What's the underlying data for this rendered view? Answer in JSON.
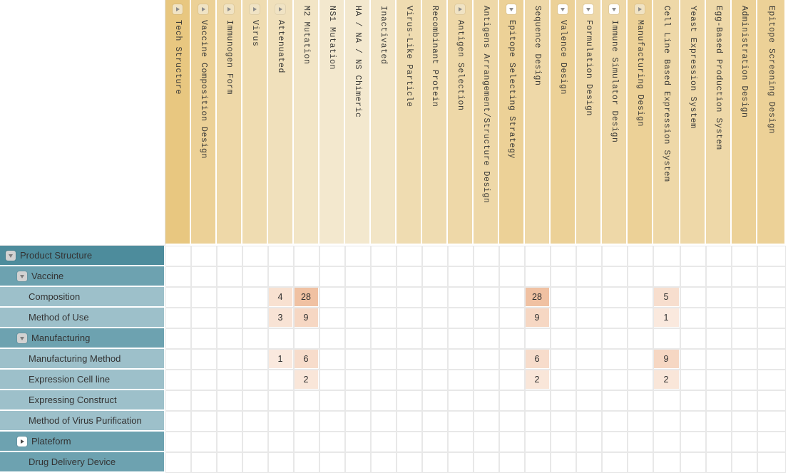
{
  "columns": [
    {
      "label": "Tech Structure",
      "toggle": "collapsed",
      "level": 0,
      "width": 36,
      "bg": "#e8c780"
    },
    {
      "label": "Vaccine Composition Design",
      "toggle": "collapsed",
      "level": 1,
      "width": 36,
      "bg": "#ecd197"
    },
    {
      "label": "Immunogen Form",
      "toggle": "collapsed",
      "level": 2,
      "width": 36,
      "bg": "#eed8a8"
    },
    {
      "label": "Virus",
      "toggle": "collapsed",
      "level": 3,
      "width": 36,
      "bg": "#efdcb1"
    },
    {
      "label": "Attenuated",
      "toggle": "collapsed",
      "level": 4,
      "width": 36,
      "bg": "#f0e0bb"
    },
    {
      "label": "M2 Mutation",
      "toggle": "none",
      "level": 5,
      "width": 36,
      "bg": "#f2e5c6"
    },
    {
      "label": "NS1 Mutation",
      "toggle": "none",
      "level": 5,
      "width": 36,
      "bg": "#f3e8ce"
    },
    {
      "label": "HA / NA / NS Chimeric",
      "toggle": "none",
      "level": 5,
      "width": 36,
      "bg": "#f3e8ce"
    },
    {
      "label": "Inactivated",
      "toggle": "none",
      "level": 4,
      "width": 36,
      "bg": "#f2e5c6"
    },
    {
      "label": "Virus-Like Particle",
      "toggle": "none",
      "level": 3,
      "width": 36,
      "bg": "#efdcb1"
    },
    {
      "label": "Recombinant Protein",
      "toggle": "none",
      "level": 3,
      "width": 36,
      "bg": "#efdcb1"
    },
    {
      "label": "Antigen Selection",
      "toggle": "collapsed",
      "level": 2,
      "width": 36,
      "bg": "#eed8a8"
    },
    {
      "label": "Antigens Arrangement/Structure Design",
      "toggle": "none",
      "level": 2,
      "width": 36,
      "bg": "#eed8a8"
    },
    {
      "label": "Epitope Selecting Strategy",
      "toggle": "expanded",
      "level": 2,
      "width": 36,
      "bg": "#ecd197"
    },
    {
      "label": "Sequence Design",
      "toggle": "none",
      "level": 3,
      "width": 36,
      "bg": "#eed8a8"
    },
    {
      "label": "Valence Design",
      "toggle": "expanded",
      "level": 2,
      "width": 36,
      "bg": "#ecd197"
    },
    {
      "label": "Formulation Design",
      "toggle": "expanded",
      "level": 2,
      "width": 36,
      "bg": "#eed8a8"
    },
    {
      "label": "Immune Simulator Design",
      "toggle": "expanded",
      "level": 2,
      "width": 36,
      "bg": "#eed8a8"
    },
    {
      "label": "Manufacturing Design",
      "toggle": "collapsed",
      "level": 1,
      "width": 36,
      "bg": "#ecd197"
    },
    {
      "label": "Cell Line Based Expression System",
      "toggle": "none",
      "level": 2,
      "width": 38,
      "bg": "#eed8a8"
    },
    {
      "label": "Yeast Expression System",
      "toggle": "none",
      "level": 2,
      "width": 36,
      "bg": "#eed8a8"
    },
    {
      "label": "Egg-Based Production System",
      "toggle": "none",
      "level": 2,
      "width": 36,
      "bg": "#eed8a8"
    },
    {
      "label": "Administration Design",
      "toggle": "none",
      "level": 1,
      "width": 36,
      "bg": "#ecd197"
    },
    {
      "label": "Epitope Screening Design",
      "toggle": "none",
      "level": 1,
      "width": 40,
      "bg": "#ecd197"
    }
  ],
  "rows": [
    {
      "label": "Product Structure",
      "level": 0,
      "toggle": "expanded"
    },
    {
      "label": "Vaccine",
      "level": 1,
      "toggle": "expanded"
    },
    {
      "label": "Composition",
      "level": 2,
      "toggle": "none"
    },
    {
      "label": "Method of Use",
      "level": 2,
      "toggle": "none"
    },
    {
      "label": "Manufacturing",
      "level": 1,
      "toggle": "expanded"
    },
    {
      "label": "Manufacturing Method",
      "level": 2,
      "toggle": "none"
    },
    {
      "label": "Expression Cell line",
      "level": 2,
      "toggle": "none"
    },
    {
      "label": "Expressing Construct",
      "level": 2,
      "toggle": "none"
    },
    {
      "label": "Method of Virus Purification",
      "level": 2,
      "toggle": "none"
    },
    {
      "label": "Plateform",
      "level": 1,
      "toggle": "collapsed"
    },
    {
      "label": "Drug Delivery Device",
      "level": 1,
      "toggle": "none"
    }
  ],
  "cells": [
    [
      null,
      null,
      null,
      null,
      null,
      null,
      null,
      null,
      null,
      null,
      null,
      null,
      null,
      null,
      null,
      null,
      null,
      null,
      null,
      null,
      null,
      null,
      null,
      null
    ],
    [
      null,
      null,
      null,
      null,
      null,
      null,
      null,
      null,
      null,
      null,
      null,
      null,
      null,
      null,
      null,
      null,
      null,
      null,
      null,
      null,
      null,
      null,
      null,
      null
    ],
    [
      null,
      null,
      null,
      null,
      "4",
      "28",
      null,
      null,
      null,
      null,
      null,
      null,
      null,
      null,
      "28",
      null,
      null,
      null,
      null,
      "5",
      null,
      null,
      null,
      null
    ],
    [
      null,
      null,
      null,
      null,
      "3",
      "9",
      null,
      null,
      null,
      null,
      null,
      null,
      null,
      null,
      "9",
      null,
      null,
      null,
      null,
      "1",
      null,
      null,
      null,
      null
    ],
    [
      null,
      null,
      null,
      null,
      null,
      null,
      null,
      null,
      null,
      null,
      null,
      null,
      null,
      null,
      null,
      null,
      null,
      null,
      null,
      null,
      null,
      null,
      null,
      null
    ],
    [
      null,
      null,
      null,
      null,
      "1",
      "6",
      null,
      null,
      null,
      null,
      null,
      null,
      null,
      null,
      "6",
      null,
      null,
      null,
      null,
      "9",
      null,
      null,
      null,
      null
    ],
    [
      null,
      null,
      null,
      null,
      null,
      "2",
      null,
      null,
      null,
      null,
      null,
      null,
      null,
      null,
      "2",
      null,
      null,
      null,
      null,
      "2",
      null,
      null,
      null,
      null
    ],
    [
      null,
      null,
      null,
      null,
      null,
      null,
      null,
      null,
      null,
      null,
      null,
      null,
      null,
      null,
      null,
      null,
      null,
      null,
      null,
      null,
      null,
      null,
      null,
      null
    ],
    [
      null,
      null,
      null,
      null,
      null,
      null,
      null,
      null,
      null,
      null,
      null,
      null,
      null,
      null,
      null,
      null,
      null,
      null,
      null,
      null,
      null,
      null,
      null,
      null
    ],
    [
      null,
      null,
      null,
      null,
      null,
      null,
      null,
      null,
      null,
      null,
      null,
      null,
      null,
      null,
      null,
      null,
      null,
      null,
      null,
      null,
      null,
      null,
      null,
      null
    ],
    [
      null,
      null,
      null,
      null,
      null,
      null,
      null,
      null,
      null,
      null,
      null,
      null,
      null,
      null,
      null,
      null,
      null,
      null,
      null,
      null,
      null,
      null,
      null,
      null
    ]
  ],
  "colors": {
    "row_level0": "#4d8c9c",
    "row_level1": "#6da2b0",
    "row_level2": "#9dc0ca",
    "header_base": "#e8c780",
    "value_high": "#f1c6a6",
    "value_mid": "#f8ddca",
    "value_low": "#fcf1ea",
    "grid_line": "#e8e8e8"
  },
  "value_scale": {
    "max": 28,
    "note": "cell tint intensity scales with value"
  }
}
